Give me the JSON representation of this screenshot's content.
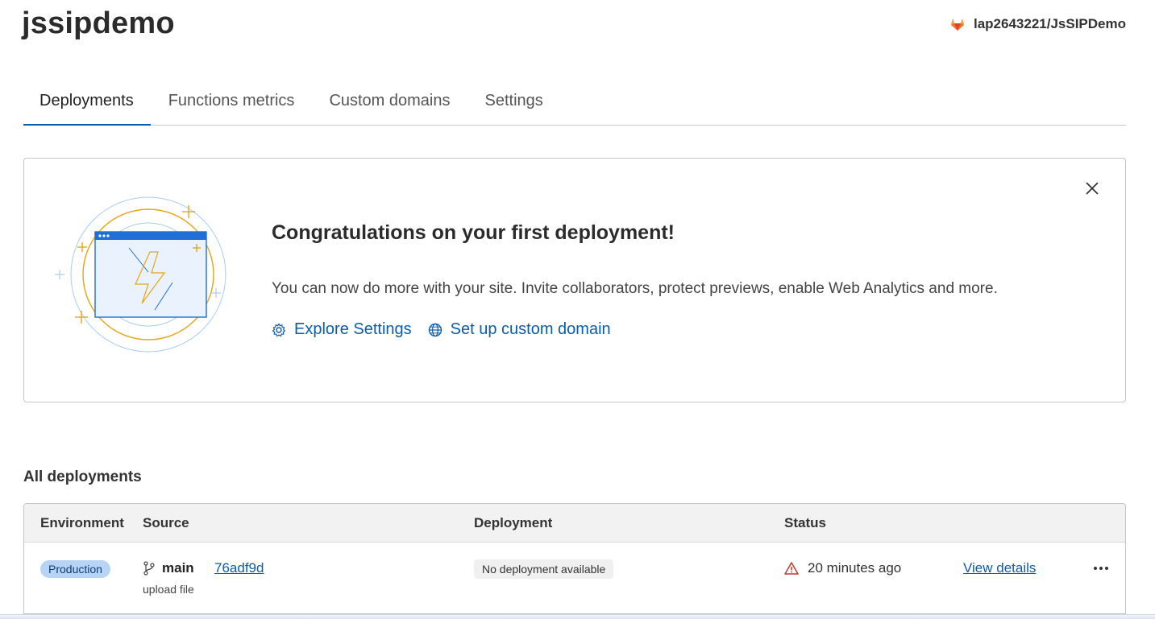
{
  "header": {
    "title": "jssipdemo",
    "repo": {
      "icon": "gitlab-icon",
      "label": "lap2643221/JsSIPDemo"
    }
  },
  "tabs": [
    {
      "label": "Deployments",
      "active": true
    },
    {
      "label": "Functions metrics",
      "active": false
    },
    {
      "label": "Custom domains",
      "active": false
    },
    {
      "label": "Settings",
      "active": false
    }
  ],
  "banner": {
    "heading": "Congratulations on your first deployment!",
    "description": "You can now do more with your site. Invite collaborators, protect previews, enable Web Analytics and more.",
    "links": [
      {
        "icon": "gear-icon",
        "label": "Explore Settings"
      },
      {
        "icon": "globe-icon",
        "label": "Set up custom domain"
      }
    ],
    "close_icon": "close-icon"
  },
  "deployments": {
    "section_title": "All deployments",
    "columns": [
      "Environment",
      "Source",
      "Deployment",
      "Status"
    ],
    "rows": [
      {
        "environment": "Production",
        "branch": "main",
        "commit": "76adf9d",
        "source_note": "upload file",
        "deployment": "No deployment available",
        "status": "20 minutes ago",
        "status_icon": "warning-icon",
        "action": "View details",
        "more_icon": "more-icon"
      }
    ]
  },
  "colors": {
    "accent": "#0b5cad",
    "badge_bg": "#b8d4f5",
    "warning": "#c0392b",
    "gitlab_orange": "#fc6d26"
  }
}
